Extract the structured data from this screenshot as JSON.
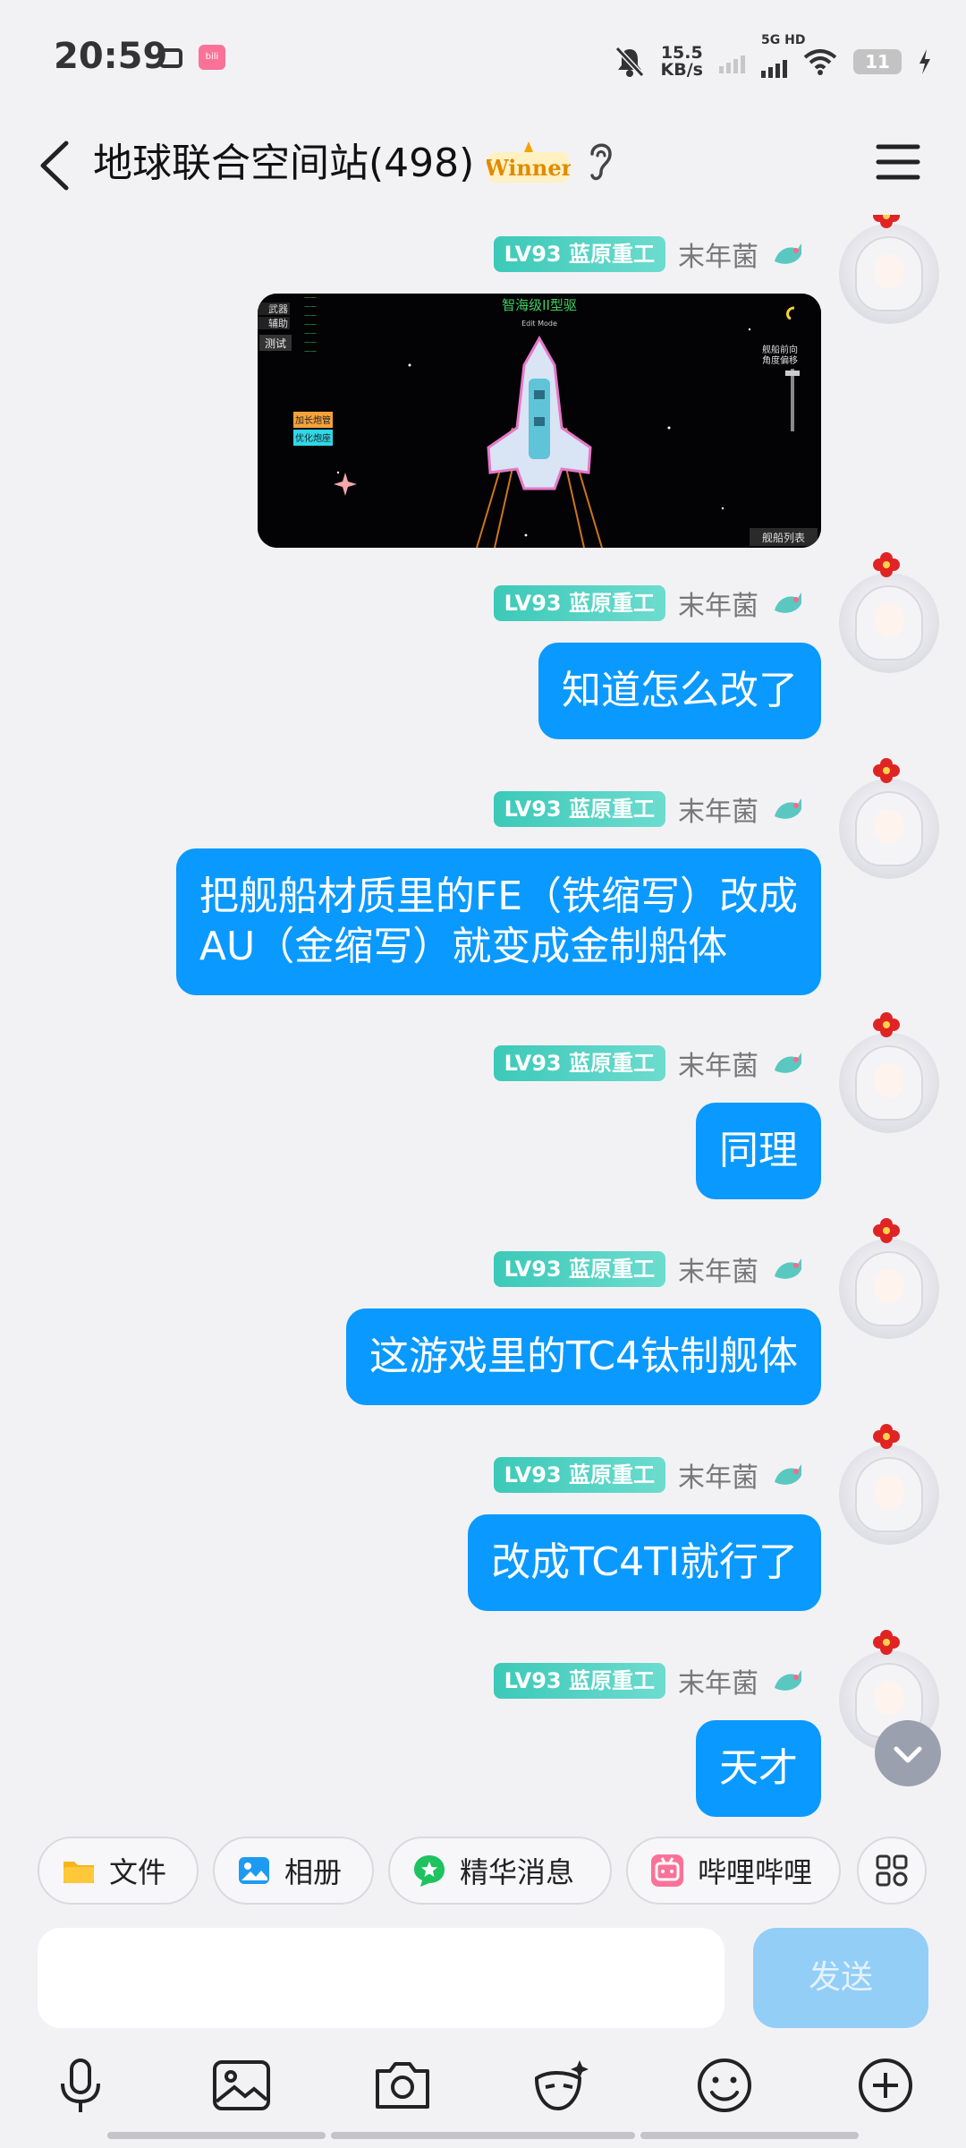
{
  "status_bar": {
    "time": "20:59",
    "net_speed_value": "15.5",
    "net_speed_unit": "KB/s",
    "network_type": "5G HD",
    "battery": "11"
  },
  "header": {
    "title": "地球联合空间站(498)",
    "badge_text": "Winner"
  },
  "messages": [
    {
      "type": "image",
      "sender": "末年菌",
      "level": "LV93 蓝原重工",
      "image": {
        "caption": "智海级II型驱",
        "sub_caption": "Edit Mode",
        "left_tabs": [
          "武器",
          "辅助",
          "测试"
        ],
        "right_label_1": "舰船前向",
        "right_label_2": "角度偏移",
        "buttons": [
          "加长炮管",
          "优化炮座"
        ],
        "bottom_button": "舰船列表"
      }
    },
    {
      "type": "text",
      "sender": "末年菌",
      "level": "LV93 蓝原重工",
      "lines": [
        "知道怎么改了"
      ]
    },
    {
      "type": "text",
      "sender": "末年菌",
      "level": "LV93 蓝原重工",
      "lines": [
        "把舰船材质里的FE（铁缩写）改成",
        "AU（金缩写）就变成金制船体"
      ]
    },
    {
      "type": "text",
      "sender": "末年菌",
      "level": "LV93 蓝原重工",
      "lines": [
        "同理"
      ]
    },
    {
      "type": "text",
      "sender": "末年菌",
      "level": "LV93 蓝原重工",
      "lines": [
        "这游戏里的TC4钛制舰体"
      ]
    },
    {
      "type": "text",
      "sender": "末年菌",
      "level": "LV93 蓝原重工",
      "lines": [
        "改成TC4TI就行了"
      ]
    },
    {
      "type": "text",
      "sender": "末年菌",
      "level": "LV93 蓝原重工",
      "lines": [
        "天才"
      ]
    }
  ],
  "quick_actions": [
    {
      "label": "文件",
      "icon": "folder-icon",
      "color": "#f5b51c"
    },
    {
      "label": "相册",
      "icon": "photo-album-icon",
      "color": "#1d9bf0"
    },
    {
      "label": "精华消息",
      "icon": "star-icon",
      "color": "#1ec35f"
    },
    {
      "label": "哔哩哔哩",
      "icon": "bilibili-icon",
      "color": "#fb7299"
    }
  ],
  "input": {
    "placeholder": "",
    "send_label": "发送"
  },
  "colors": {
    "bubble": "#0a99ff",
    "level_badge": "#3cc9b8",
    "background": "#f2f2f5"
  }
}
